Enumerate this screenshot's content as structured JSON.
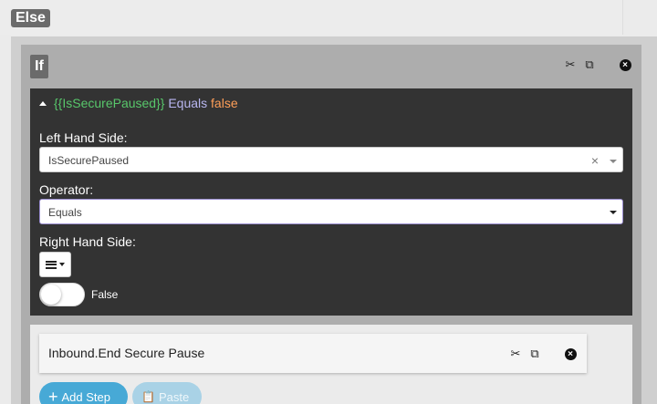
{
  "else_block": {
    "label": "Else"
  },
  "if_block": {
    "label": "If",
    "actions": {
      "cut_icon": "scissors-icon",
      "copy_icon": "copy-icon",
      "close_icon": "close-circle-icon"
    }
  },
  "condition": {
    "summary": {
      "variable": "{{IsSecurePaused}}",
      "operator": "Equals",
      "value": "false"
    },
    "left_hand_side": {
      "label": "Left Hand Side:",
      "value": "IsSecurePaused"
    },
    "operator": {
      "label": "Operator:",
      "value": "Equals"
    },
    "right_hand_side": {
      "label": "Right Hand Side:",
      "toggle_label": "False",
      "toggle_on": false
    }
  },
  "step": {
    "title": "Inbound.End Secure Pause",
    "actions": {
      "cut_icon": "scissors-icon",
      "copy_icon": "copy-icon",
      "close_icon": "close-circle-icon"
    }
  },
  "buttons": {
    "add_step": "Add Step",
    "paste": "Paste"
  },
  "colors": {
    "panel_dark": "#333333",
    "variable_green": "#58c76b",
    "operator_lavender": "#b8b6f0",
    "value_orange": "#ff9f58",
    "add_button": "#47a9d6",
    "paste_button_disabled": "#a9d2e6"
  }
}
